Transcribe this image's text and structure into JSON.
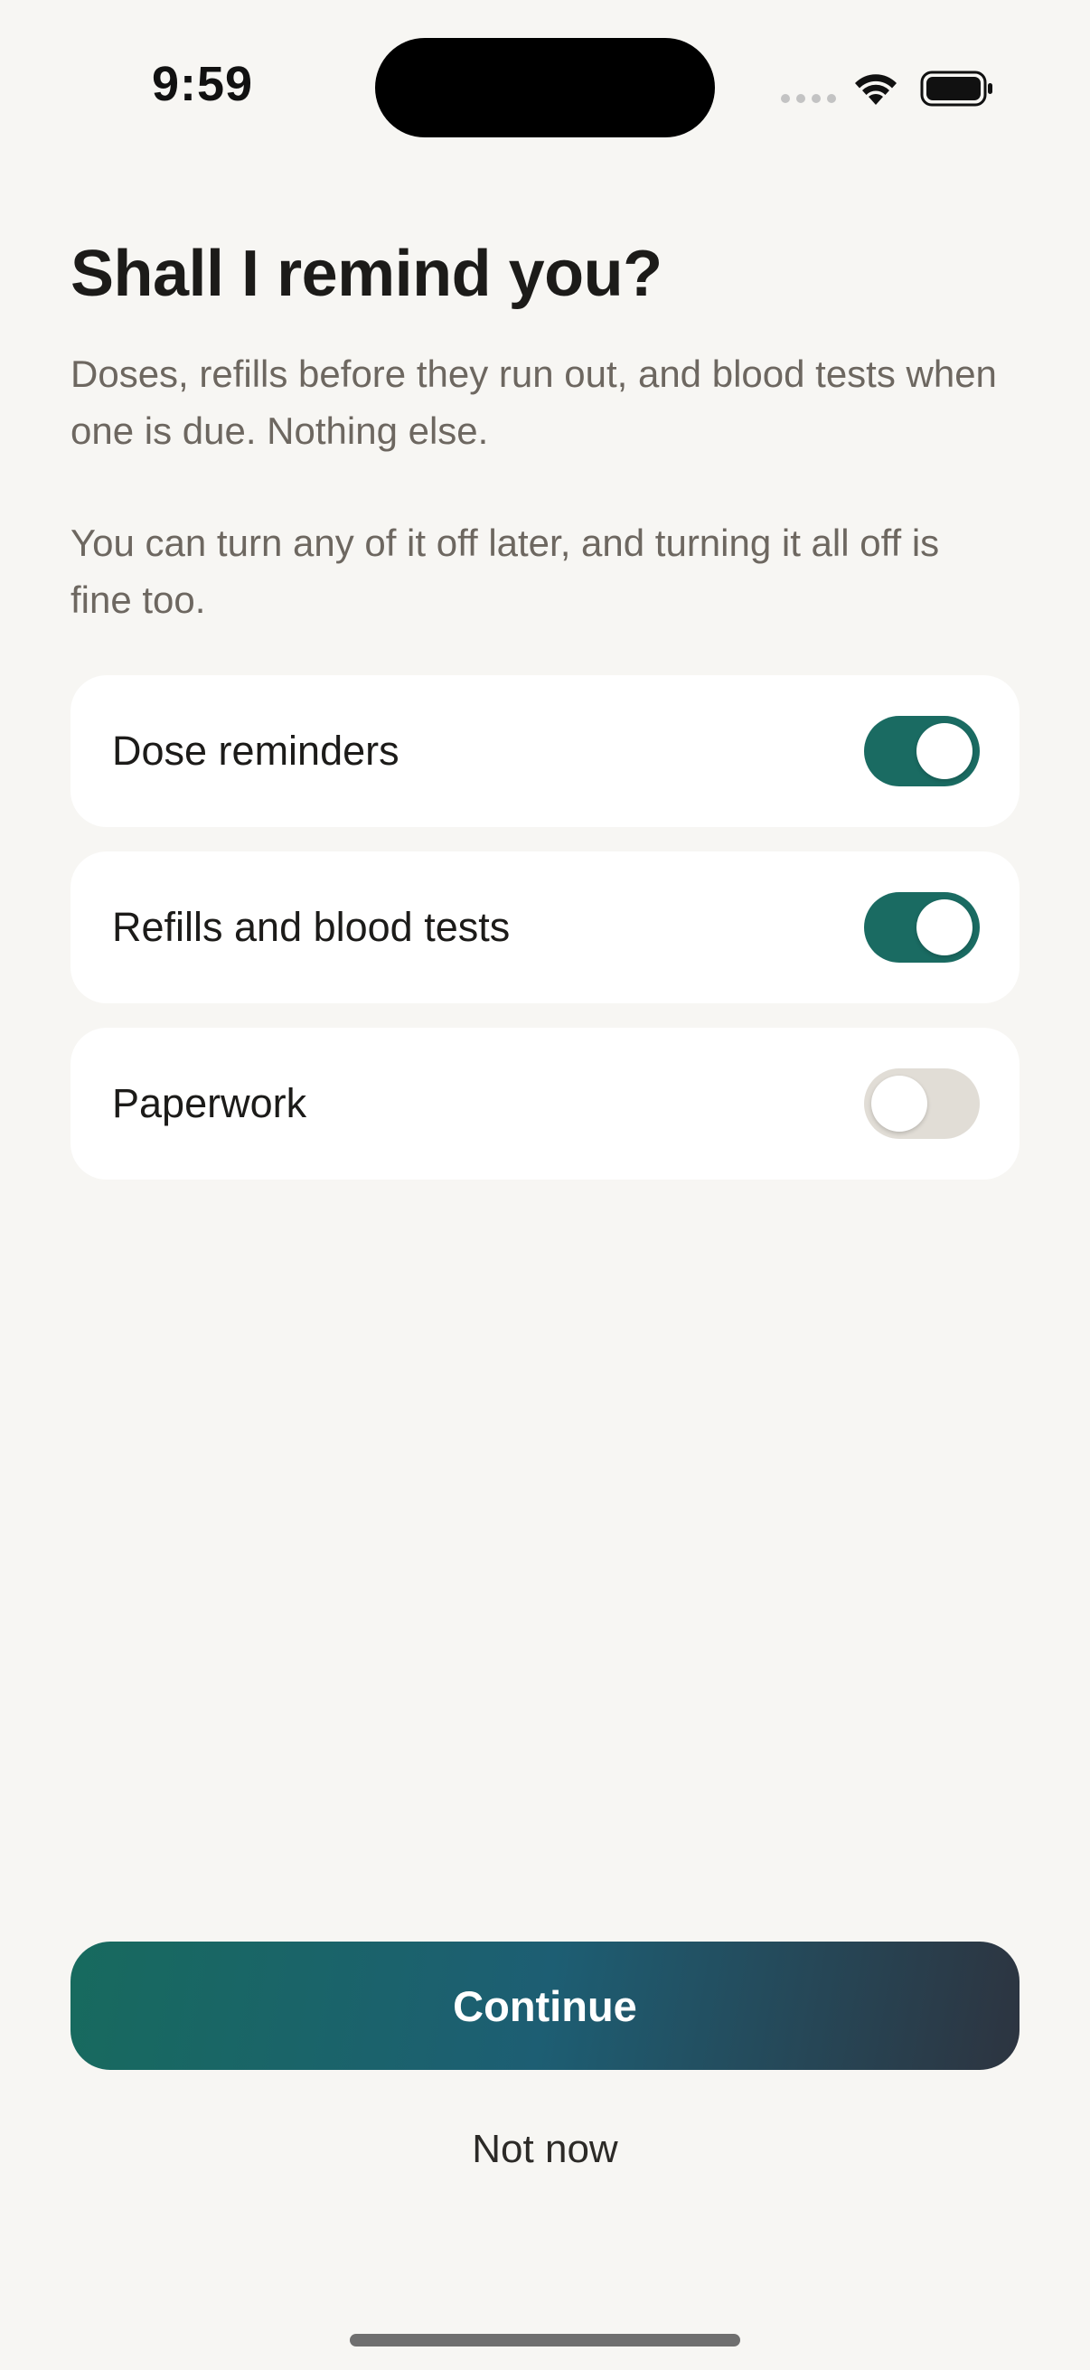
{
  "status_bar": {
    "time": "9:59",
    "signal_icon": "signal-dots-icon",
    "wifi_icon": "wifi-icon",
    "battery_icon": "battery-icon"
  },
  "header": {
    "title": "Shall I remind you?",
    "description": "Doses, refills before they run out, and blood tests when one is due. Nothing else.",
    "note": "You can turn any of it off later, and turning it all off is fine too."
  },
  "settings": [
    {
      "label": "Dose reminders",
      "enabled": true
    },
    {
      "label": "Refills and blood tests",
      "enabled": true
    },
    {
      "label": "Paperwork",
      "enabled": false
    }
  ],
  "actions": {
    "continue_label": "Continue",
    "not_now_label": "Not now"
  },
  "colors": {
    "background": "#f7f6f3",
    "toggle_on": "#1a6b62",
    "toggle_off": "#e1ddd6",
    "button_gradient_start": "#176a5e",
    "button_gradient_end": "#2d3440"
  }
}
